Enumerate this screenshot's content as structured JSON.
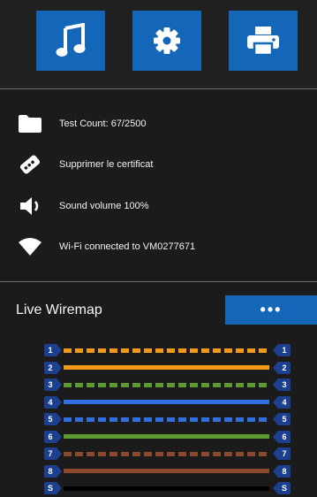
{
  "toolbar": {
    "icons": [
      "music-note-icon",
      "gear-icon",
      "printer-icon"
    ],
    "accent_color": "#1467b8"
  },
  "status": {
    "test_count": "Test Count: 67/2500",
    "certificate": "Supprimer le certificat",
    "sound": "Sound volume 100%",
    "wifi": "Wi-Fi connected to VM0277671"
  },
  "wiremap": {
    "title": "Live Wiremap",
    "more_label": "•••",
    "pairs": [
      {
        "left": "1",
        "right": "1",
        "color": "#f59a17",
        "dashed": true
      },
      {
        "left": "2",
        "right": "2",
        "color": "#f59a17",
        "dashed": false
      },
      {
        "left": "3",
        "right": "3",
        "color": "#5e9a32",
        "dashed": true
      },
      {
        "left": "4",
        "right": "4",
        "color": "#2f6fe0",
        "dashed": false
      },
      {
        "left": "5",
        "right": "5",
        "color": "#2f6fe0",
        "dashed": true
      },
      {
        "left": "6",
        "right": "6",
        "color": "#5e9a32",
        "dashed": false
      },
      {
        "left": "7",
        "right": "7",
        "color": "#8b4a2e",
        "dashed": true
      },
      {
        "left": "8",
        "right": "8",
        "color": "#8b4a2e",
        "dashed": false
      },
      {
        "left": "S",
        "right": "S",
        "color": "#000000",
        "dashed": false
      }
    ]
  }
}
